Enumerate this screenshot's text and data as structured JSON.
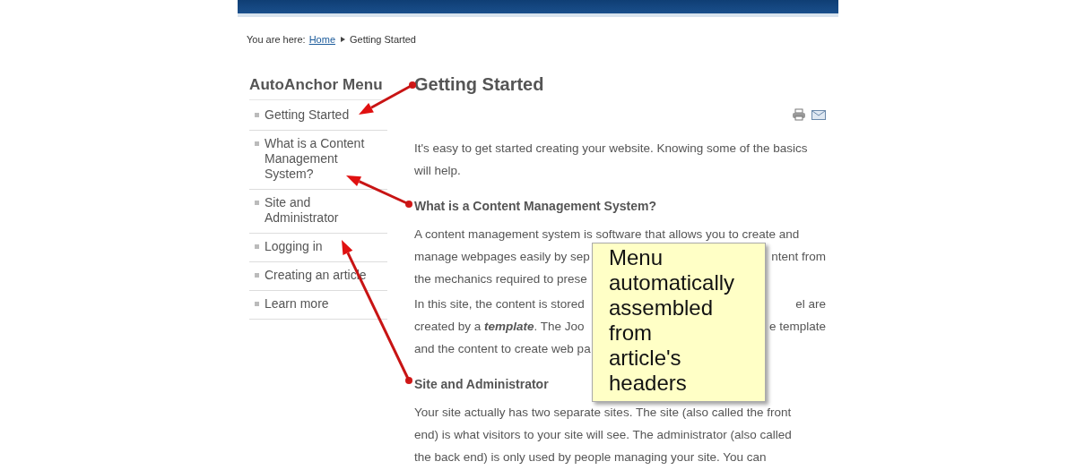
{
  "breadcrumb": {
    "label": "You are here:",
    "items": [
      "Home",
      "Getting Started"
    ]
  },
  "sidebar": {
    "title": "AutoAnchor Menu",
    "items": [
      "Getting Started",
      "What is a Content Management System?",
      "Site and Administrator",
      "Logging in",
      "Creating an article",
      "Learn more"
    ]
  },
  "article": {
    "title": "Getting Started",
    "blocks": [
      {
        "kind": "paragraph",
        "lines": [
          {
            "kind": "full",
            "text": "It's easy to get started creating your website. Knowing some of the basics"
          },
          {
            "kind": "full",
            "text": "will help."
          }
        ]
      },
      {
        "kind": "heading",
        "text": "What is a Content Management System?"
      },
      {
        "kind": "paragraph",
        "lines": [
          {
            "kind": "full",
            "text": "A content management system is software that allows you to create and"
          },
          {
            "kind": "split",
            "left": "manage webpages easily by sep",
            "right": "ntent from"
          },
          {
            "kind": "split",
            "left": "the mechanics required to prese"
          }
        ]
      },
      {
        "kind": "paragraph",
        "lines": [
          {
            "kind": "split",
            "left": "In this site, the content is stored",
            "right": "el are"
          },
          {
            "kind": "split",
            "left": "created by a **template**. The Joo",
            "right": "e template"
          },
          {
            "kind": "split",
            "left": "and the content to create web pa"
          }
        ]
      },
      {
        "kind": "heading",
        "text": "Site and Administrator"
      },
      {
        "kind": "paragraph",
        "lines": [
          {
            "kind": "full",
            "text": "Your site actually has two separate sites. The site (also called the front"
          },
          {
            "kind": "full",
            "text": "end) is what visitors to your site will see. The administrator (also called"
          },
          {
            "kind": "full",
            "text": "the back end) is only used by people managing your site. You can"
          }
        ]
      }
    ]
  },
  "callout": {
    "text": "Menu automatically assembled from article's headers"
  }
}
